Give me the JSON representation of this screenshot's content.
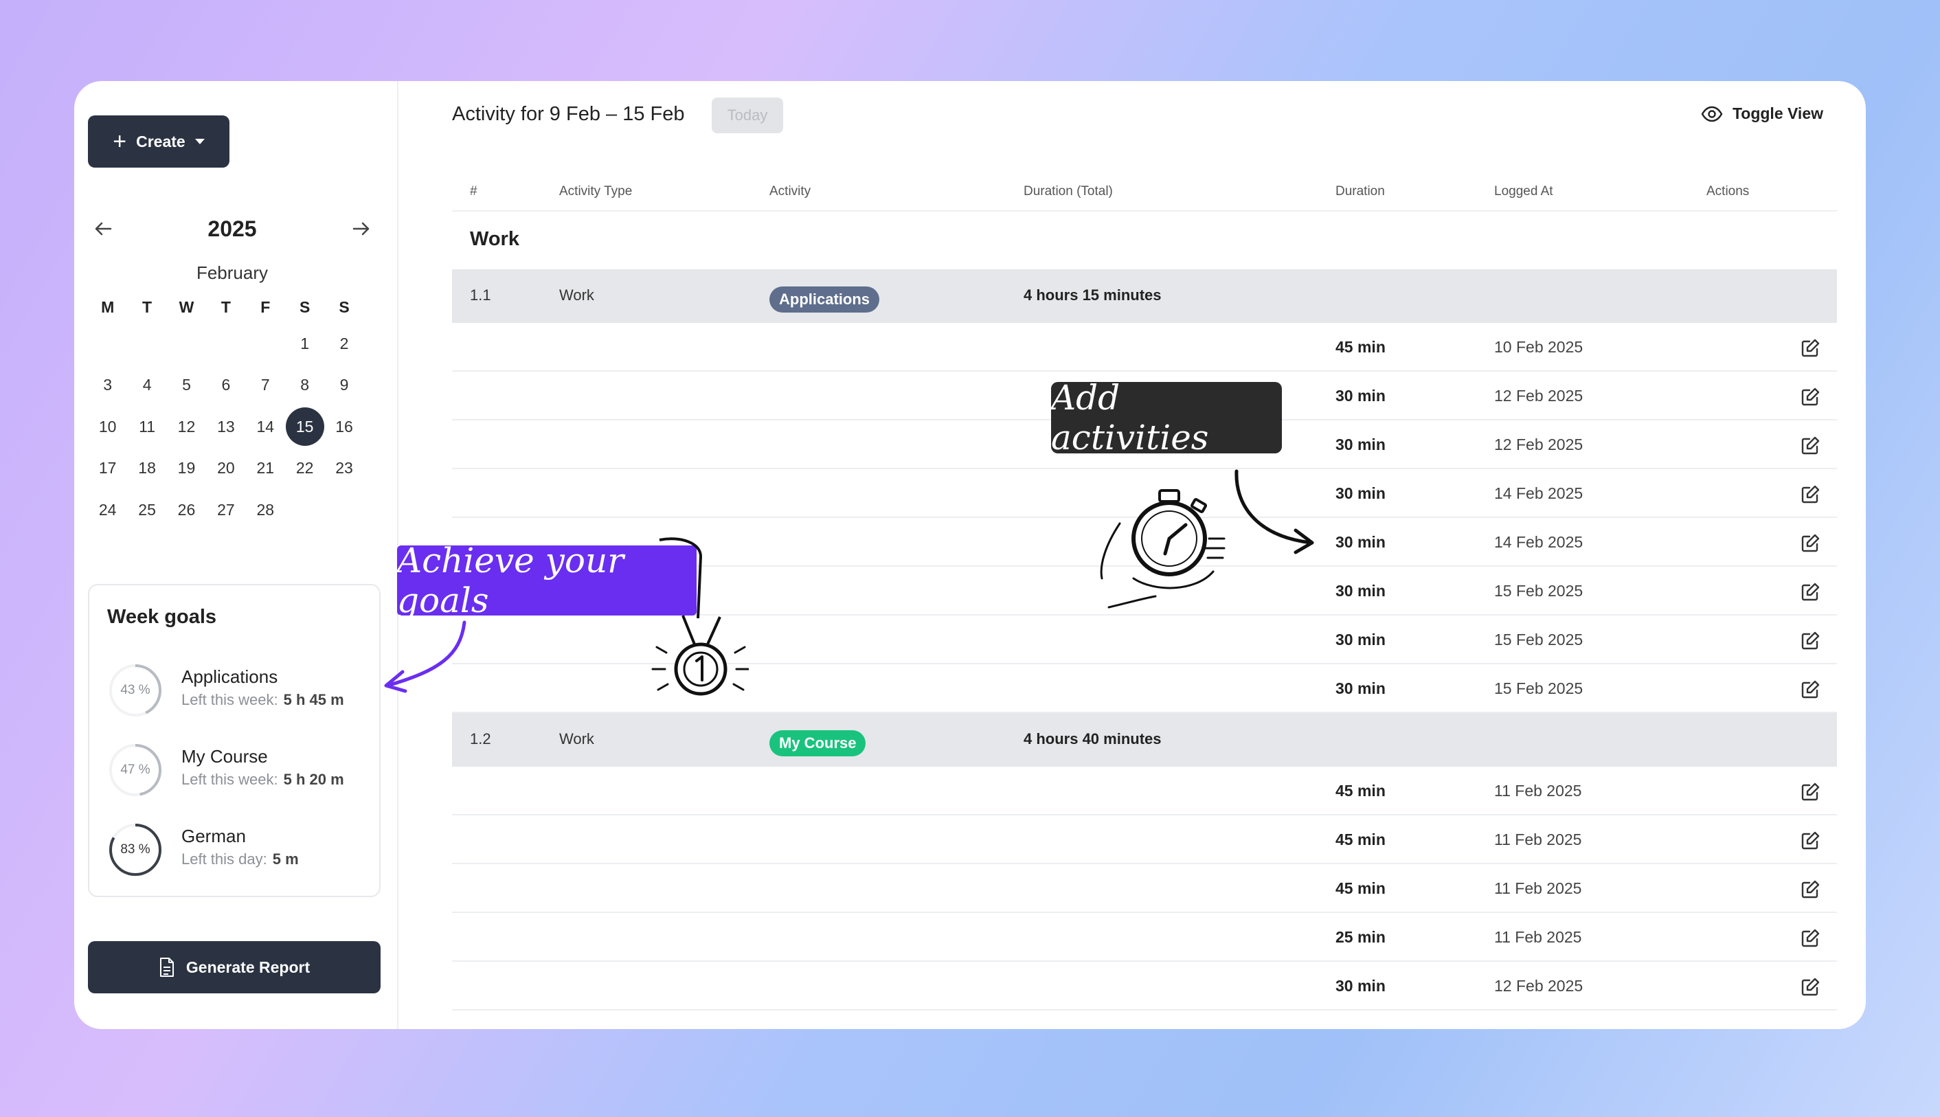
{
  "create_label": "Create",
  "calendar": {
    "year": "2025",
    "month": "February",
    "weekdays": [
      "M",
      "T",
      "W",
      "T",
      "F",
      "S",
      "S"
    ],
    "selected_day": "15",
    "weeks": [
      [
        "",
        "",
        "",
        "",
        "",
        "1",
        "2"
      ],
      [
        "3",
        "4",
        "5",
        "6",
        "7",
        "8",
        "9"
      ],
      [
        "10",
        "11",
        "12",
        "13",
        "14",
        "15",
        "16"
      ],
      [
        "17",
        "18",
        "19",
        "20",
        "21",
        "22",
        "23"
      ],
      [
        "24",
        "25",
        "26",
        "27",
        "28",
        "",
        ""
      ]
    ]
  },
  "week_goals": {
    "title": "Week goals",
    "items": [
      {
        "name": "Applications",
        "percent_label": "43 %",
        "progress": 0.43,
        "left_label": "Left this week:",
        "left_value": "5 h 45 m"
      },
      {
        "name": "My Course",
        "percent_label": "47 %",
        "progress": 0.47,
        "left_label": "Left this week:",
        "left_value": "5 h 20 m"
      },
      {
        "name": "German",
        "percent_label": "83 %",
        "progress": 0.83,
        "left_label": "Left this day:",
        "left_value": "5 m"
      }
    ]
  },
  "report_label": "Generate Report",
  "main": {
    "title": "Activity for 9 Feb – 15 Feb",
    "today_label": "Today",
    "toggle_label": "Toggle View"
  },
  "table": {
    "headers": {
      "num": "#",
      "type": "Activity Type",
      "activity": "Activity",
      "total": "Duration (Total)",
      "duration": "Duration",
      "logged": "Logged At",
      "actions": "Actions"
    },
    "group": "Work",
    "categories": [
      {
        "num": "1.1",
        "type": "Work",
        "activity": "Applications",
        "color": "#5e6e8c",
        "total": "4 hours 15 minutes",
        "entries": [
          {
            "duration": "45 min",
            "logged": "10 Feb 2025"
          },
          {
            "duration": "30 min",
            "logged": "12 Feb 2025"
          },
          {
            "duration": "30 min",
            "logged": "12 Feb 2025"
          },
          {
            "duration": "30 min",
            "logged": "14 Feb 2025"
          },
          {
            "duration": "30 min",
            "logged": "14 Feb 2025"
          },
          {
            "duration": "30 min",
            "logged": "15 Feb 2025"
          },
          {
            "duration": "30 min",
            "logged": "15 Feb 2025"
          },
          {
            "duration": "30 min",
            "logged": "15 Feb 2025"
          }
        ]
      },
      {
        "num": "1.2",
        "type": "Work",
        "activity": "My Course",
        "color": "#19c37d",
        "total": "4 hours 40 minutes",
        "entries": [
          {
            "duration": "45 min",
            "logged": "11 Feb 2025"
          },
          {
            "duration": "45 min",
            "logged": "11 Feb 2025"
          },
          {
            "duration": "45 min",
            "logged": "11 Feb 2025"
          },
          {
            "duration": "25 min",
            "logged": "11 Feb 2025"
          },
          {
            "duration": "30 min",
            "logged": "12 Feb 2025"
          }
        ]
      }
    ]
  },
  "annotations": {
    "add_activities": "Add activities",
    "achieve_goals": "Achieve your goals"
  },
  "colors": {
    "dark": "#2b3342",
    "accent_purple": "#6a2ef0",
    "applications_pill": "#5e6e8c",
    "my_course_pill": "#19c37d"
  }
}
